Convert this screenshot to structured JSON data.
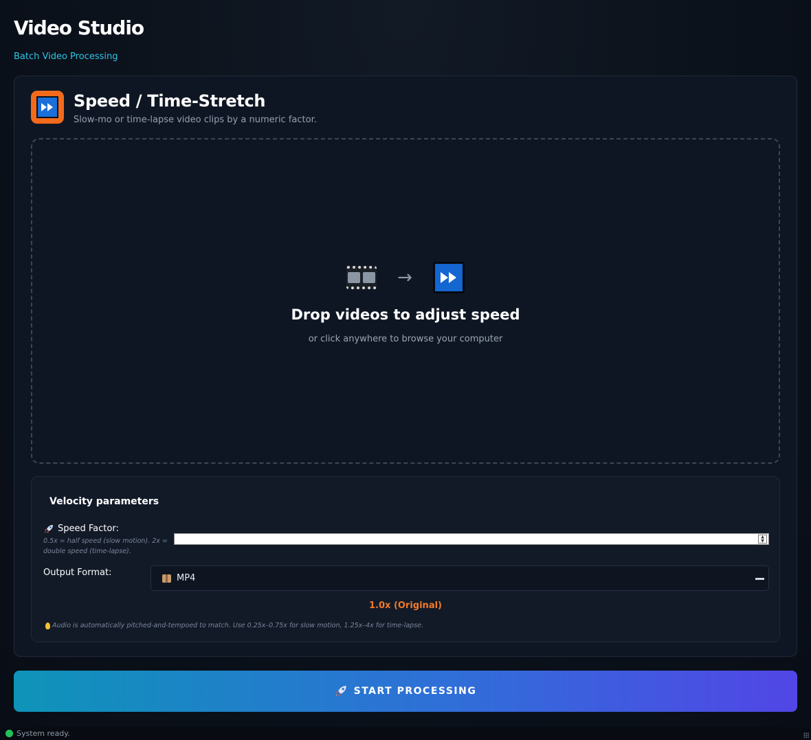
{
  "app": {
    "title": "Video Studio",
    "subtitle": "Batch Video Processing"
  },
  "tool": {
    "icon": "fast-forward-icon",
    "title": "Speed / Time-Stretch",
    "description": "Slow-mo or time-lapse video clips by a numeric factor."
  },
  "dropzone": {
    "icons": [
      "film-frames-icon",
      "arrow-right-icon",
      "fast-forward-icon"
    ],
    "arrow_glyph": "→",
    "title": "Drop videos to adjust speed",
    "hint": "or click anywhere to browse your computer"
  },
  "params": {
    "title": "Velocity parameters",
    "speed_label": "Speed Factor:",
    "speed_help": "0.5x = half speed (slow motion). 2x = double speed (time-lapse).",
    "speed_value": "",
    "format_label": "Output Format:",
    "format_selected": "MP4",
    "speed_readout": "1.0x (Original)",
    "audio_note": "Audio is automatically pitched-and-tempoed to match. Use 0.25x–0.75x for slow motion, 1.25x–4x for time-lapse."
  },
  "actions": {
    "start_label": "START PROCESSING"
  },
  "status": {
    "text": "System ready.",
    "color": "#22c25a"
  },
  "colors": {
    "accent_cyan": "#2ec5e6",
    "accent_orange": "#f07a28",
    "button_gradient_start": "#0e94b8",
    "button_gradient_end": "#5146e6"
  }
}
